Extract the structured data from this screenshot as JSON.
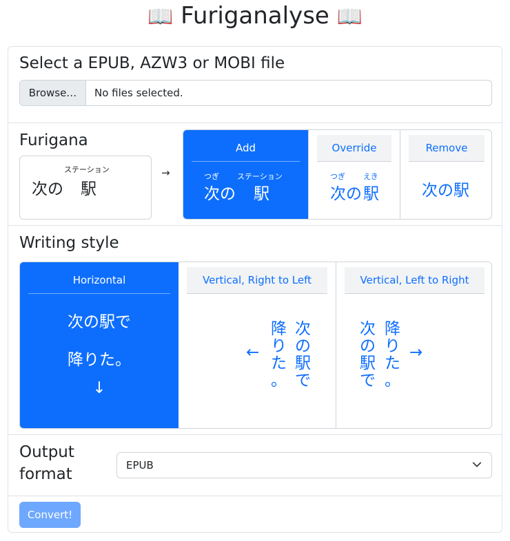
{
  "title": {
    "text": "Furiganalyse",
    "icon_left": "📖",
    "icon_right": "📖"
  },
  "file_section": {
    "heading": "Select a EPUB, AZW3 or MOBI file",
    "browse_label": "Browse…",
    "status": "No files selected."
  },
  "furigana_section": {
    "heading": "Furigana",
    "example": {
      "word1": "次の",
      "word2": "駅",
      "ruby2": "ステーション"
    },
    "arrow": "→",
    "options": [
      {
        "label": "Add",
        "word1": "次の",
        "ruby1": "つぎ",
        "word2": "駅",
        "ruby2": "ステーション",
        "selected": true
      },
      {
        "label": "Override",
        "word1": "次の",
        "ruby1": "つぎ",
        "word2": "駅",
        "ruby2": "えき",
        "selected": false
      },
      {
        "label": "Remove",
        "text": "次の駅",
        "selected": false
      }
    ]
  },
  "writing_section": {
    "heading": "Writing style",
    "options": [
      {
        "label": "Horizontal",
        "line1": "次の駅で",
        "line2": "降りた。",
        "arrow": "↓",
        "selected": true
      },
      {
        "label": "Vertical, Right to Left",
        "col1": "次の駅で",
        "col2": "降りた。",
        "arrow": "←",
        "selected": false
      },
      {
        "label": "Vertical, Left to Right",
        "col1": "次の駅で",
        "col2": "降りた。",
        "arrow": "→",
        "selected": false
      }
    ]
  },
  "output_section": {
    "heading_line1": "Output",
    "heading_line2": "format",
    "selected": "EPUB"
  },
  "convert_label": "Convert!",
  "colors": {
    "accent": "#0d6efd",
    "button_disabled": "#6ea8fe",
    "border": "#dee2e6"
  }
}
